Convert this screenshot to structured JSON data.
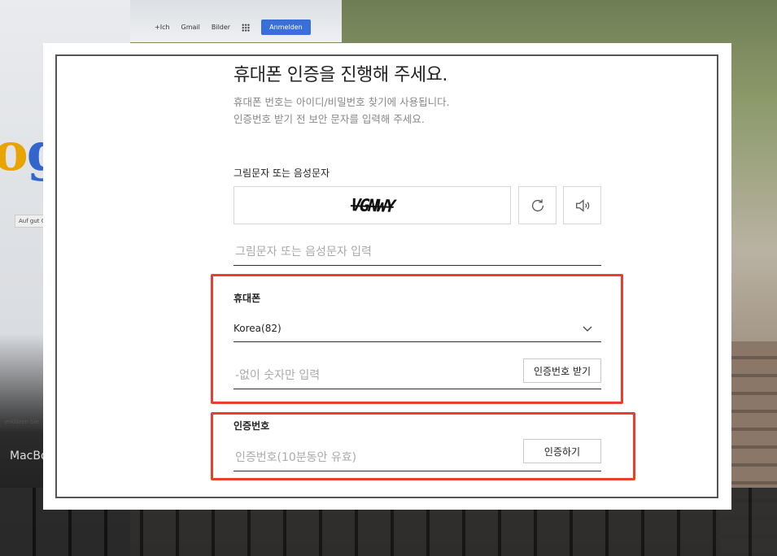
{
  "background": {
    "topbar": [
      "+Ich",
      "Gmail",
      "Bilder"
    ],
    "anmelden_label": "Anmelden",
    "search_button": "Auf gut G",
    "footer_text": "erklären Sie",
    "laptop_brand": "MacBo"
  },
  "header": {
    "title": "휴대폰 인증을 진행해 주세요.",
    "subtitle_line1": "휴대폰 번호는 아이디/비밀번호 찾기에 사용됩니다.",
    "subtitle_line2": "인증번호 받기 전 보안 문자를 입력해 주세요."
  },
  "captcha": {
    "label": "그림문자 또는 음성문자",
    "image_text": "VGNWY",
    "refresh_icon": "refresh-icon",
    "audio_icon": "speaker-icon",
    "input_placeholder": "그림문자 또는 음성문자 입력"
  },
  "phone": {
    "label": "휴대폰",
    "country_selected": "Korea(82)",
    "number_placeholder": "-없이 숫자만 입력",
    "get_code_button": "인증번호 받기"
  },
  "verification": {
    "label": "인증번호",
    "input_placeholder": "인증번호(10분동안 유효)",
    "verify_button": "인증하기"
  },
  "colors": {
    "highlight": "#e8402c",
    "border": "#d7d7d7",
    "text": "#222222",
    "placeholder": "#aaaaaa"
  }
}
